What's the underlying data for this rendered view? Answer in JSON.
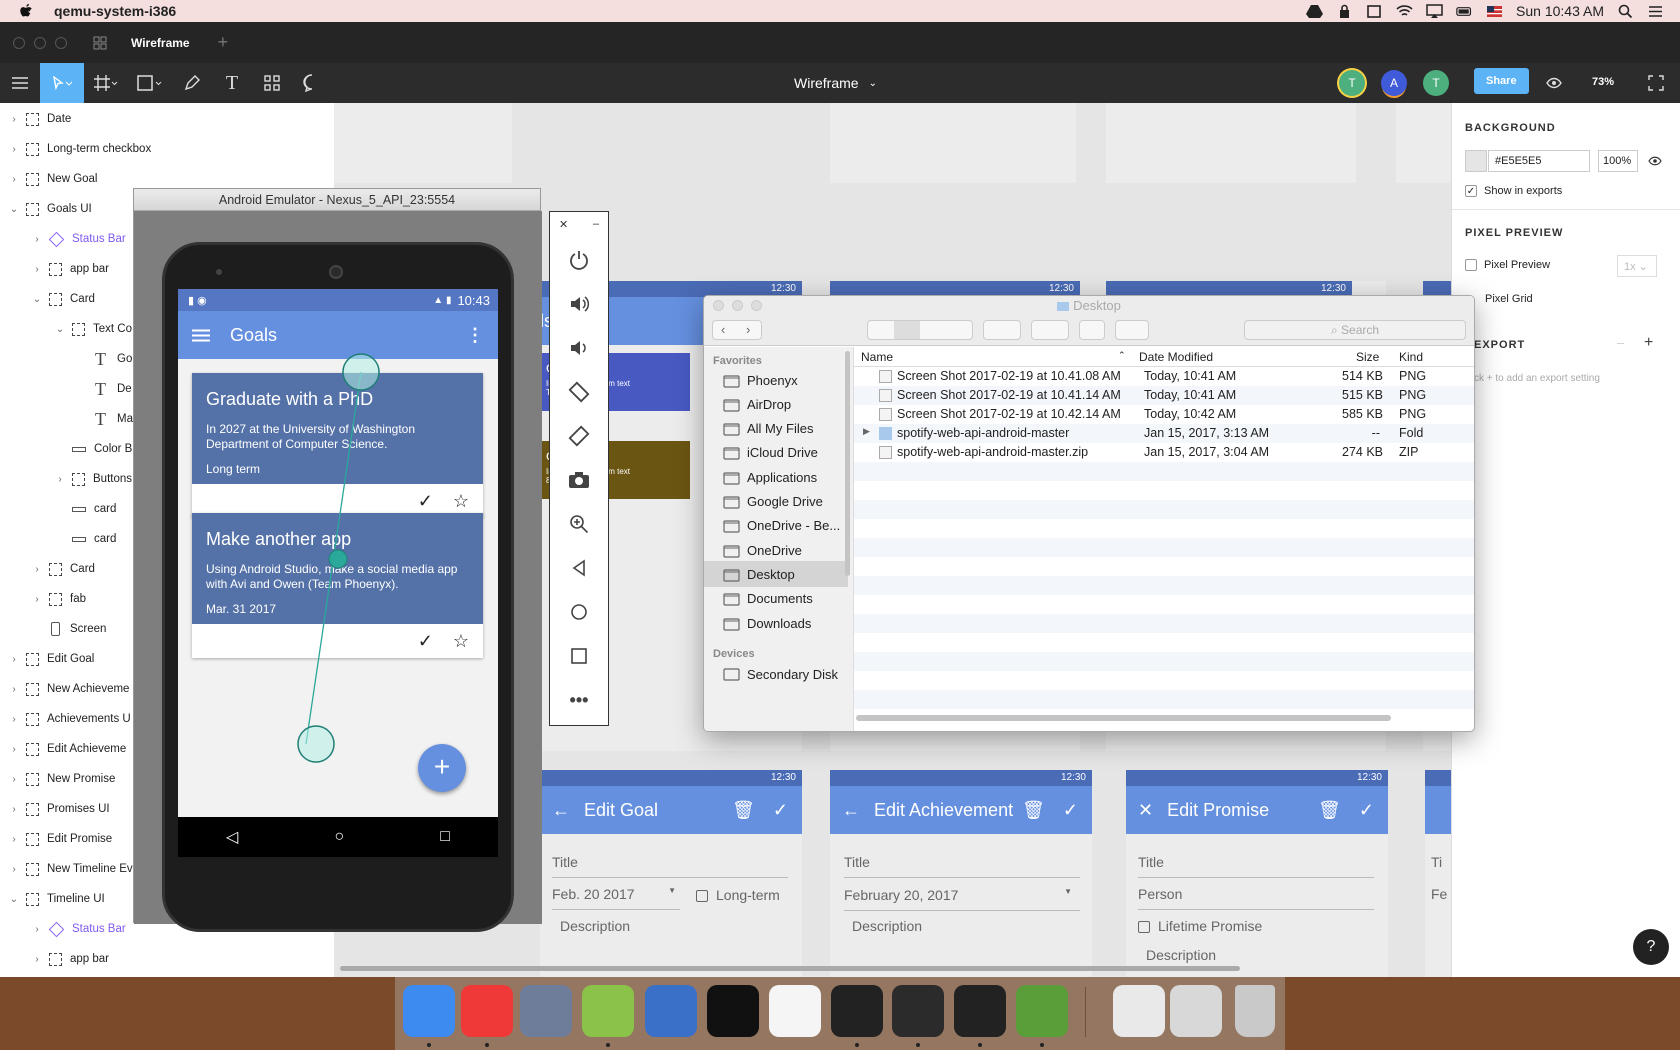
{
  "menubar": {
    "app": "qemu-system-i386",
    "clock": "Sun 10:43 AM"
  },
  "tabs": [
    {
      "label": "Wireframe"
    }
  ],
  "toolbar": {
    "doc": "Wireframe",
    "zoom": "73%",
    "share": "Share",
    "avatars": [
      {
        "letter": "T",
        "color": "#4caf7d"
      },
      {
        "letter": "A",
        "color": "#3f5bd9"
      },
      {
        "letter": "T",
        "color": "#4caf7d"
      }
    ]
  },
  "layers": [
    {
      "label": "Date",
      "indent": 0,
      "caret": "›",
      "type": "frame"
    },
    {
      "label": "Long-term checkbox",
      "indent": 0,
      "caret": "›",
      "type": "frame"
    },
    {
      "label": "New Goal",
      "indent": 0,
      "caret": "›",
      "type": "frame"
    },
    {
      "label": "Goals UI",
      "indent": 0,
      "caret": "⌄",
      "type": "frame"
    },
    {
      "label": "Status Bar",
      "indent": 1,
      "caret": "›",
      "type": "symbol"
    },
    {
      "label": "app bar",
      "indent": 1,
      "caret": "›",
      "type": "frame"
    },
    {
      "label": "Card",
      "indent": 1,
      "caret": "⌄",
      "type": "frame"
    },
    {
      "label": "Text Co",
      "indent": 2,
      "caret": "⌄",
      "type": "frame"
    },
    {
      "label": "Go",
      "indent": 3,
      "caret": "",
      "type": "text"
    },
    {
      "label": "De",
      "indent": 3,
      "caret": "",
      "type": "text"
    },
    {
      "label": "Ma",
      "indent": 3,
      "caret": "",
      "type": "text"
    },
    {
      "label": "Color B",
      "indent": 2,
      "caret": "",
      "type": "rect"
    },
    {
      "label": "Buttons",
      "indent": 2,
      "caret": "›",
      "type": "frame"
    },
    {
      "label": "card",
      "indent": 2,
      "caret": "",
      "type": "rect"
    },
    {
      "label": "card",
      "indent": 2,
      "caret": "",
      "type": "rect"
    },
    {
      "label": "Card",
      "indent": 1,
      "caret": "›",
      "type": "frame"
    },
    {
      "label": "fab",
      "indent": 1,
      "caret": "›",
      "type": "frame"
    },
    {
      "label": "Screen",
      "indent": 1,
      "caret": "",
      "type": "screen"
    },
    {
      "label": "Edit Goal",
      "indent": 0,
      "caret": "›",
      "type": "frame"
    },
    {
      "label": "New Achieveme",
      "indent": 0,
      "caret": "›",
      "type": "frame"
    },
    {
      "label": "Achievements U",
      "indent": 0,
      "caret": "›",
      "type": "frame"
    },
    {
      "label": "Edit Achieveme",
      "indent": 0,
      "caret": "›",
      "type": "frame"
    },
    {
      "label": "New Promise",
      "indent": 0,
      "caret": "›",
      "type": "frame"
    },
    {
      "label": "Promises UI",
      "indent": 0,
      "caret": "›",
      "type": "frame"
    },
    {
      "label": "Edit Promise",
      "indent": 0,
      "caret": "›",
      "type": "frame"
    },
    {
      "label": "New Timeline Ev",
      "indent": 0,
      "caret": "›",
      "type": "frame"
    },
    {
      "label": "Timeline UI",
      "indent": 0,
      "caret": "⌄",
      "type": "frame"
    },
    {
      "label": "Status Bar",
      "indent": 1,
      "caret": "›",
      "type": "symbol"
    },
    {
      "label": "app bar",
      "indent": 1,
      "caret": "›",
      "type": "frame"
    }
  ],
  "canvas": {
    "status_time": "12:30",
    "partial_title": "ls",
    "partial_goal1": "oal #1",
    "partial_goal1_text": "Insert Lorem Ipsum text",
    "partial_goal1_term": "Term",
    "partial_goal2": "oal #2",
    "partial_goal2_text": "Insert Lorem Ipsum text",
    "partial_goal2_num": "8",
    "edit_goal": {
      "title": "Edit Goal",
      "f1": "Title",
      "f2": "Feb. 20 2017",
      "chk": "Long-term",
      "f3": "Description"
    },
    "edit_ach": {
      "title": "Edit Achievement",
      "f1": "Title",
      "f2": "February 20, 2017",
      "f3": "Description"
    },
    "edit_promise": {
      "title": "Edit Promise",
      "f1": "Title",
      "f2": "Person",
      "chk": "Lifetime Promise",
      "f3": "Description"
    },
    "partial_right": {
      "f1": "Ti",
      "f2": "Fe"
    }
  },
  "right_panel": {
    "bg_heading": "BACKGROUND",
    "hex": "#E5E5E5",
    "opacity": "100%",
    "show_exports": "Show in exports",
    "pixel_heading": "PIXEL PREVIEW",
    "pixel_preview": "Pixel Preview",
    "scale": "1x",
    "pixel_grid": "Pixel Grid",
    "export_heading": "EXPORT",
    "export_hint": "ck + to add an export setting"
  },
  "emulator": {
    "title": "Android Emulator - Nexus_5_API_23:5554",
    "time": "10:43",
    "app_title": "Goals",
    "cards": [
      {
        "title": "Graduate with a PhD",
        "desc": "In 2027 at the University of Washington Department of Computer Science.",
        "meta": "Long term"
      },
      {
        "title": "Make another app",
        "desc": "Using Android Studio, make a social media app with Avi and Owen (Team Phoenyx).",
        "meta": "Mar. 31 2017"
      }
    ]
  },
  "finder": {
    "title": "Desktop",
    "search": "Search",
    "sidebar": {
      "favorites_heading": "Favorites",
      "favorites": [
        "Phoenyx",
        "AirDrop",
        "All My Files",
        "iCloud Drive",
        "Applications",
        "Google Drive",
        "OneDrive - Be...",
        "OneDrive",
        "Desktop",
        "Documents",
        "Downloads"
      ],
      "devices_heading": "Devices",
      "devices": [
        "Secondary Disk"
      ]
    },
    "columns": {
      "name": "Name",
      "date": "Date Modified",
      "size": "Size",
      "kind": "Kind"
    },
    "files": [
      {
        "name": "Screen Shot 2017-02-19 at 10.41.08 AM",
        "date": "Today, 10:41 AM",
        "size": "514 KB",
        "kind": "PNG"
      },
      {
        "name": "Screen Shot 2017-02-19 at 10.41.14 AM",
        "date": "Today, 10:41 AM",
        "size": "515 KB",
        "kind": "PNG"
      },
      {
        "name": "Screen Shot 2017-02-19 at 10.42.14 AM",
        "date": "Today, 10:42 AM",
        "size": "585 KB",
        "kind": "PNG"
      },
      {
        "name": "spotify-web-api-android-master",
        "date": "Jan 15, 2017, 3:13 AM",
        "size": "--",
        "kind": "Fold"
      },
      {
        "name": "spotify-web-api-android-master.zip",
        "date": "Jan 15, 2017, 3:04 AM",
        "size": "274 KB",
        "kind": "ZIP"
      }
    ]
  },
  "dock": [
    "Finder",
    "Vivaldi",
    "Launchpad",
    "Android Studio",
    "Xcode",
    "IntelliJ IDEA",
    "Slack",
    "Inkscape",
    "GitHub Desktop",
    "Inkscape",
    "Android Emulator",
    "Archive",
    "Screenshot",
    "Trash"
  ]
}
